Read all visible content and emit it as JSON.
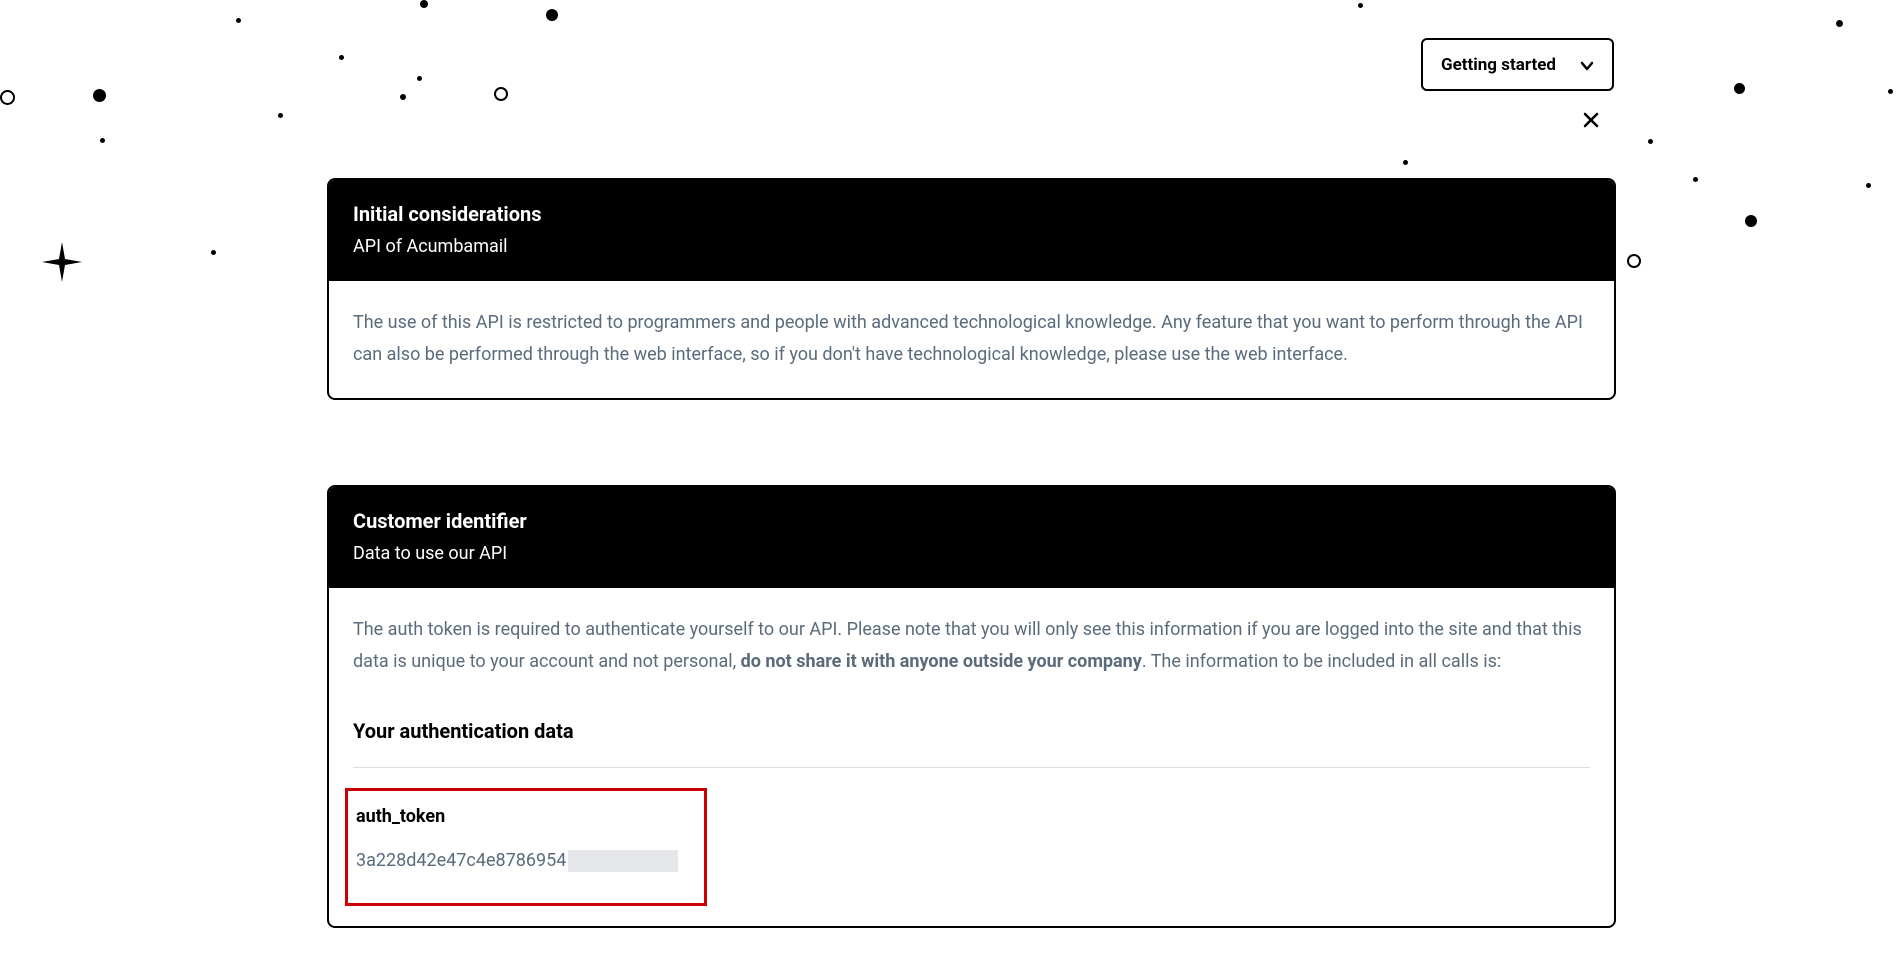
{
  "dropdown": {
    "label": "Getting started"
  },
  "card1": {
    "title": "Initial considerations",
    "subtitle": "API of Acumbamail",
    "body": "The use of this API is restricted to programmers and people with advanced technological knowledge. Any feature that you want to perform through the API can also be performed through the web interface, so if you don't have technological knowledge, please use the web interface."
  },
  "card2": {
    "title": "Customer identifier",
    "subtitle": "Data to use our API",
    "body_part1": "The auth token is required to authenticate yourself to our API. Please note that you will only see this information if you are logged into the site and that this data is unique to your account and not personal, ",
    "body_bold": "do not share it with anyone outside your company",
    "body_part2": ". The information to be included in all calls is:",
    "auth_heading": "Your authentication data",
    "auth_label": "auth_token",
    "auth_value_visible": "3a228d42e47c4e8786954"
  }
}
